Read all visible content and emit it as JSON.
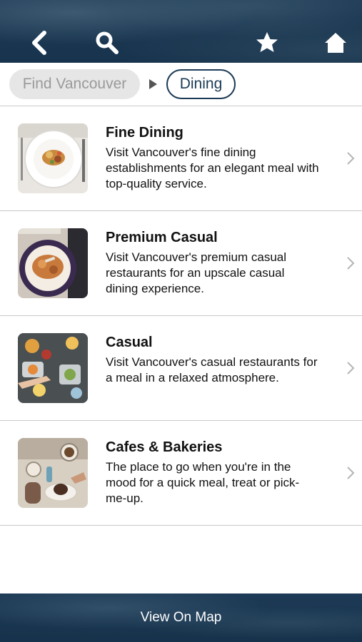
{
  "nav": {
    "icons": [
      "back-icon",
      "search-icon",
      "star-icon",
      "home-icon"
    ]
  },
  "breadcrumb": {
    "root": "Find Vancouver",
    "current": "Dining"
  },
  "items": [
    {
      "title": "Fine Dining",
      "description": "Visit Vancouver's fine dining establishments for an elegant meal with top-quality service."
    },
    {
      "title": "Premium Casual",
      "description": "Visit Vancouver's premium casual restaurants for an upscale casual dining experience."
    },
    {
      "title": "Casual",
      "description": "Visit Vancouver's casual restaurants for a meal in a relaxed atmosphere."
    },
    {
      "title": "Cafes & Bakeries",
      "description": "The place to go when you're in the mood for a quick meal, treat or pick-me-up."
    }
  ],
  "footer": {
    "map_label": "View On Map"
  },
  "colors": {
    "brand_navy": "#1b3a55",
    "crumb_bg": "#e6e6e6",
    "divider": "#c9c9c9"
  }
}
